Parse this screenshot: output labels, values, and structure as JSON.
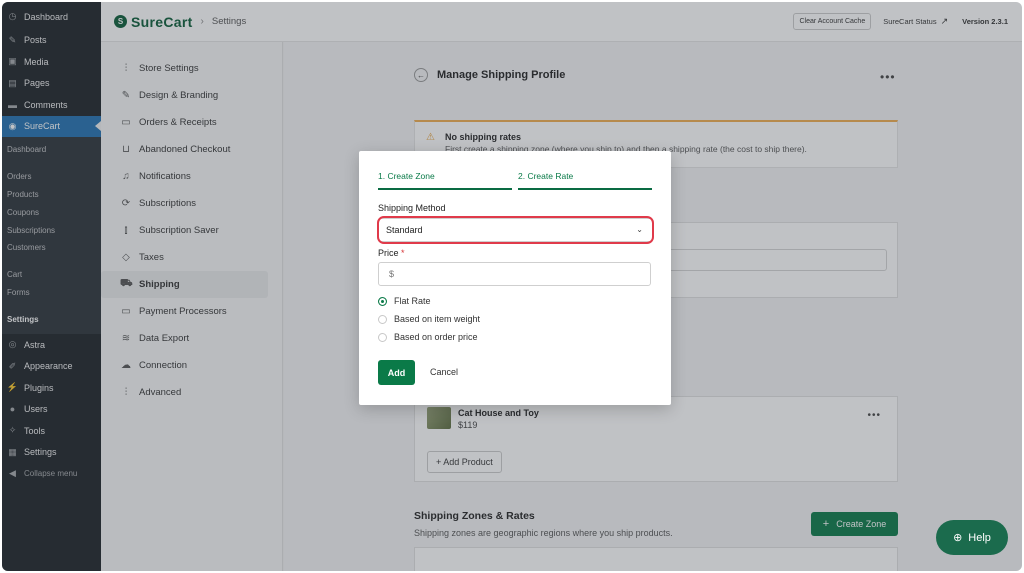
{
  "wp_menu": {
    "top": [
      {
        "label": "Dashboard",
        "icon": "dashboard-icon"
      },
      {
        "label": "Posts",
        "icon": "pin-icon"
      },
      {
        "label": "Media",
        "icon": "media-icon"
      },
      {
        "label": "Pages",
        "icon": "pages-icon"
      },
      {
        "label": "Comments",
        "icon": "comment-icon"
      },
      {
        "label": "SureCart",
        "icon": "surecart-icon"
      }
    ],
    "sub": [
      {
        "label": "Dashboard"
      },
      {
        "label": "Orders"
      },
      {
        "label": "Products"
      },
      {
        "label": "Coupons"
      },
      {
        "label": "Subscriptions"
      },
      {
        "label": "Customers"
      },
      {
        "label": "Cart"
      },
      {
        "label": "Forms"
      },
      {
        "label": "Settings"
      }
    ],
    "bottom": [
      {
        "label": "Astra",
        "icon": "astra-icon"
      },
      {
        "label": "Appearance",
        "icon": "brush-icon"
      },
      {
        "label": "Plugins",
        "icon": "plugin-icon"
      },
      {
        "label": "Users",
        "icon": "user-icon"
      },
      {
        "label": "Tools",
        "icon": "wrench-icon"
      },
      {
        "label": "Settings",
        "icon": "settings-icon"
      },
      {
        "label": "Collapse menu",
        "icon": "collapse-icon"
      }
    ]
  },
  "topbar": {
    "brand": "SureCart",
    "crumb": "Settings",
    "cache_button": "Clear Account Cache",
    "status_link": "SureCart Status",
    "version": "Version 2.3.1"
  },
  "settings_nav": [
    {
      "label": "Store Settings",
      "icon": "sliders-icon"
    },
    {
      "label": "Design & Branding",
      "icon": "brush-icon"
    },
    {
      "label": "Orders & Receipts",
      "icon": "inbox-icon"
    },
    {
      "label": "Abandoned Checkout",
      "icon": "cart-icon"
    },
    {
      "label": "Notifications",
      "icon": "bell-icon"
    },
    {
      "label": "Subscriptions",
      "icon": "subscriptions-icon"
    },
    {
      "label": "Subscription Saver",
      "icon": "bar-chart-icon"
    },
    {
      "label": "Taxes",
      "icon": "tag-icon"
    },
    {
      "label": "Shipping",
      "icon": "truck-icon"
    },
    {
      "label": "Payment Processors",
      "icon": "credit-card-icon"
    },
    {
      "label": "Data Export",
      "icon": "layers-icon"
    },
    {
      "label": "Connection",
      "icon": "cloud-icon"
    },
    {
      "label": "Advanced",
      "icon": "sliders-icon"
    }
  ],
  "main": {
    "title": "Manage Shipping Profile",
    "alert_title": "No shipping rates",
    "alert_text": "First create a shipping zone (where you ship to) and then a shipping rate (the cost to ship there).",
    "product_name": "Cat House and Toy",
    "product_price": "$119",
    "add_product": "+ Add Product",
    "zones_title": "Shipping Zones & Rates",
    "zones_subtitle": "Shipping zones are geographic regions where you ship products.",
    "create_zone": "Create Zone"
  },
  "modal": {
    "step1": "1. Create Zone",
    "step2": "2. Create Rate",
    "method_label": "Shipping Method",
    "method_value": "Standard",
    "price_label": "Price",
    "price_required": "*",
    "price_placeholder": "$",
    "options": [
      {
        "label": "Flat Rate",
        "selected": true
      },
      {
        "label": "Based on item weight",
        "selected": false
      },
      {
        "label": "Based on order price",
        "selected": false
      }
    ],
    "add_button": "Add",
    "cancel_button": "Cancel"
  },
  "help": {
    "label": "Help"
  },
  "colors": {
    "accent_green": "#0a7a48",
    "highlight_red": "#e03a4a",
    "wp_blue": "#2271b1",
    "wp_dark": "#1d2327"
  }
}
